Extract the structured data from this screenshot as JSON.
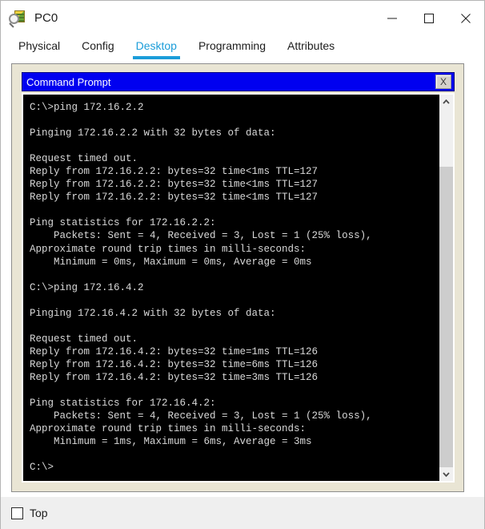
{
  "window": {
    "title": "PC0",
    "icon": "packet-tracer-icon",
    "controls": {
      "minimize": "minimize-icon",
      "maximize": "maximize-icon",
      "close": "close-icon"
    }
  },
  "tabs": [
    {
      "label": "Physical",
      "active": false
    },
    {
      "label": "Config",
      "active": false
    },
    {
      "label": "Desktop",
      "active": true
    },
    {
      "label": "Programming",
      "active": false
    },
    {
      "label": "Attributes",
      "active": false
    }
  ],
  "command_prompt": {
    "title": "Command Prompt",
    "close_label": "X",
    "accent_color": "#0000f0",
    "screen_bg": "#000000",
    "text_color": "#d8d8d8",
    "output": "C:\\>ping 172.16.2.2\n\nPinging 172.16.2.2 with 32 bytes of data:\n\nRequest timed out.\nReply from 172.16.2.2: bytes=32 time<1ms TTL=127\nReply from 172.16.2.2: bytes=32 time<1ms TTL=127\nReply from 172.16.2.2: bytes=32 time<1ms TTL=127\n\nPing statistics for 172.16.2.2:\n    Packets: Sent = 4, Received = 3, Lost = 1 (25% loss),\nApproximate round trip times in milli-seconds:\n    Minimum = 0ms, Maximum = 0ms, Average = 0ms\n\nC:\\>ping 172.16.4.2\n\nPinging 172.16.4.2 with 32 bytes of data:\n\nRequest timed out.\nReply from 172.16.4.2: bytes=32 time=1ms TTL=126\nReply from 172.16.4.2: bytes=32 time=6ms TTL=126\nReply from 172.16.4.2: bytes=32 time=3ms TTL=126\n\nPing statistics for 172.16.4.2:\n    Packets: Sent = 4, Received = 3, Lost = 1 (25% loss),\nApproximate round trip times in milli-seconds:\n    Minimum = 1ms, Maximum = 6ms, Average = 3ms\n\nC:\\>",
    "scrollbar": {
      "up_arrow": "chevron-up-icon",
      "down_arrow": "chevron-down-icon"
    }
  },
  "footer": {
    "top_checkbox_label": "Top",
    "top_checkbox_checked": false
  }
}
